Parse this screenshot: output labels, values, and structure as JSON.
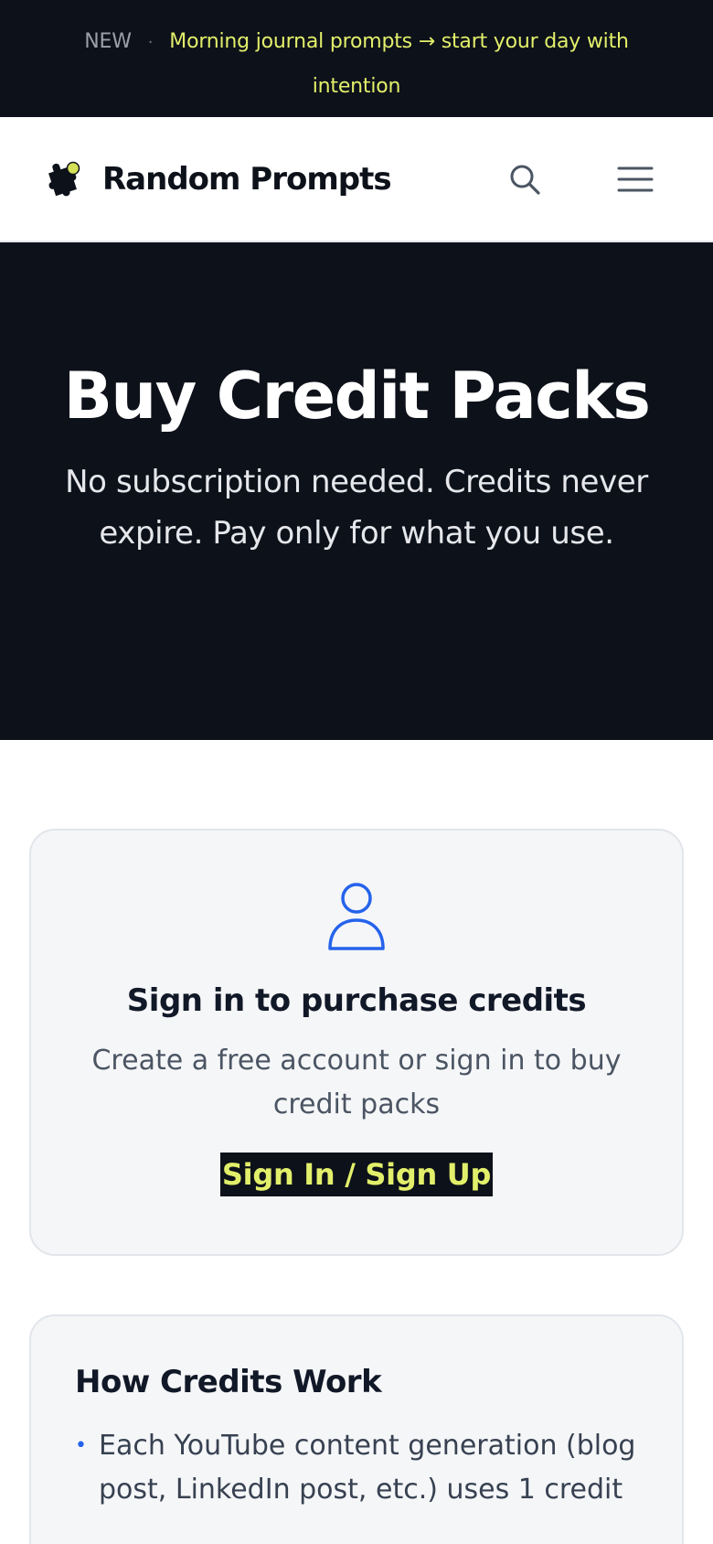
{
  "announcement": {
    "badge": "NEW",
    "separator": "·",
    "message": "Morning journal prompts → start your day with intention"
  },
  "nav": {
    "brand": "Random Prompts",
    "search_icon": "search-icon",
    "menu_icon": "hamburger-menu-icon"
  },
  "hero": {
    "title": "Buy Credit Packs",
    "subtitle": "No subscription needed. Credits never expire. Pay only for what you use."
  },
  "signin_card": {
    "icon": "user-icon",
    "title": "Sign in to purchase credits",
    "description": "Create a free account or sign in to buy credit packs",
    "button_label": "Sign In / Sign Up"
  },
  "credits_info": {
    "title": "How Credits Work",
    "items": [
      "Each YouTube content generation (blog post, LinkedIn post, etc.) uses 1 credit"
    ]
  },
  "colors": {
    "dark": "#0d111a",
    "accent": "#e2ef6a",
    "blue": "#2563eb"
  }
}
